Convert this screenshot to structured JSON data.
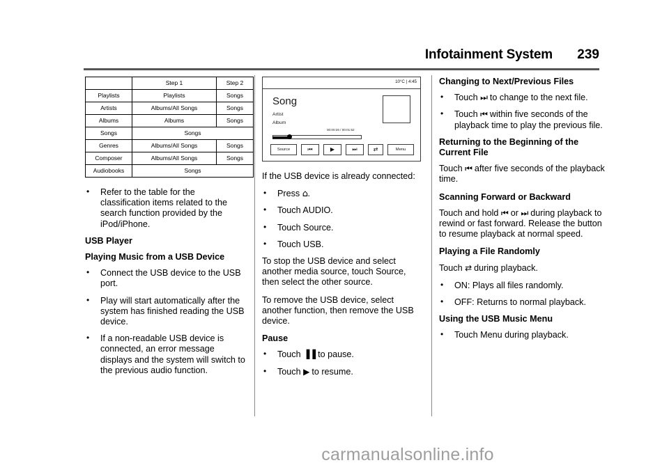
{
  "header": {
    "title": "Infotainment System",
    "page_number": "239"
  },
  "table": {
    "rows": [
      [
        "",
        "Step 1",
        "Step 2"
      ],
      [
        "Playlists",
        "Playlists",
        "Songs"
      ],
      [
        "Artists",
        "Albums/All Songs",
        "Songs"
      ],
      [
        "Albums",
        "Albums",
        "Songs"
      ],
      [
        "Songs",
        "Songs",
        ""
      ],
      [
        "Genres",
        "Albums/All Songs",
        "Songs"
      ],
      [
        "Composer",
        "Albums/All Songs",
        "Songs"
      ],
      [
        "Audiobooks",
        "Songs",
        ""
      ]
    ]
  },
  "column1": {
    "bullet_refer": "Refer to the table for the classification items related to the search function provided by the iPod/iPhone.",
    "heading_usb_player": "USB Player",
    "heading_playing_music": "Playing Music from a USB Device",
    "bullets": [
      "Connect the USB device to the USB port.",
      "Play will start automatically after the system has finished reading the USB device.",
      "If a non-readable USB device is connected, an error message displays and the system will switch to the previous audio function."
    ]
  },
  "radio_display": {
    "status": "10°C | 4:45",
    "song": "Song",
    "artist": "Artist",
    "album": "Album",
    "time": "00:00:26 / 00:01:52",
    "buttons": {
      "source": "Source",
      "previous": "⏮",
      "play": "▶",
      "next": "⏭",
      "shuffle": "⇄",
      "menu": "Menu"
    }
  },
  "column2": {
    "intro": "If the USB device is already connected:",
    "bullets": [
      {
        "pre": "Press ",
        "glyph": "⌂",
        "post": "."
      },
      {
        "pre": "Touch AUDIO.",
        "glyph": "",
        "post": ""
      },
      {
        "pre": "Touch Source.",
        "glyph": "",
        "post": ""
      },
      {
        "pre": "Touch USB.",
        "glyph": "",
        "post": ""
      }
    ],
    "para_stop": "To stop the USB device and select another media source, touch Source, then select the other source.",
    "para_remove": "To remove the USB device, select another function, then remove the USB device.",
    "heading_pause": "Pause",
    "pause_bullets": [
      {
        "pre": "Touch ",
        "glyph": "▐▐",
        "post": " to pause."
      },
      {
        "pre": "Touch ",
        "glyph": "▶",
        "post": " to resume."
      }
    ]
  },
  "column3": {
    "heading_changing": "Changing to Next/Previous Files",
    "changing_bullets": [
      {
        "pre": "Touch ",
        "glyph": "⏭",
        "post": " to change to the next file."
      },
      {
        "pre": "Touch ",
        "glyph": "⏮",
        "post": " within five seconds of the playback time to play the previous file."
      }
    ],
    "heading_returning": "Returning to the Beginning of the Current File",
    "para_returning_pre": "Touch ",
    "para_returning_glyph": "⏮",
    "para_returning_post": " after five seconds of the playback time.",
    "heading_scanning": "Scanning Forward or Backward",
    "para_scanning_pre": "Touch and hold ",
    "para_scanning_glyph1": "⏮",
    "para_scanning_mid": " or ",
    "para_scanning_glyph2": "⏭",
    "para_scanning_post": " during playback to rewind or fast forward. Release the button to resume playback at normal speed.",
    "heading_random": "Playing a File Randomly",
    "para_random_pre": "Touch ",
    "para_random_glyph": "⇄",
    "para_random_post": " during playback.",
    "random_bullets": [
      "ON: Plays all files randomly.",
      "OFF: Returns to normal playback."
    ],
    "heading_menu": "Using the USB Music Menu",
    "menu_bullets": [
      "Touch Menu during playback."
    ]
  },
  "footer": {
    "watermark": "carmanualsonline.info"
  }
}
